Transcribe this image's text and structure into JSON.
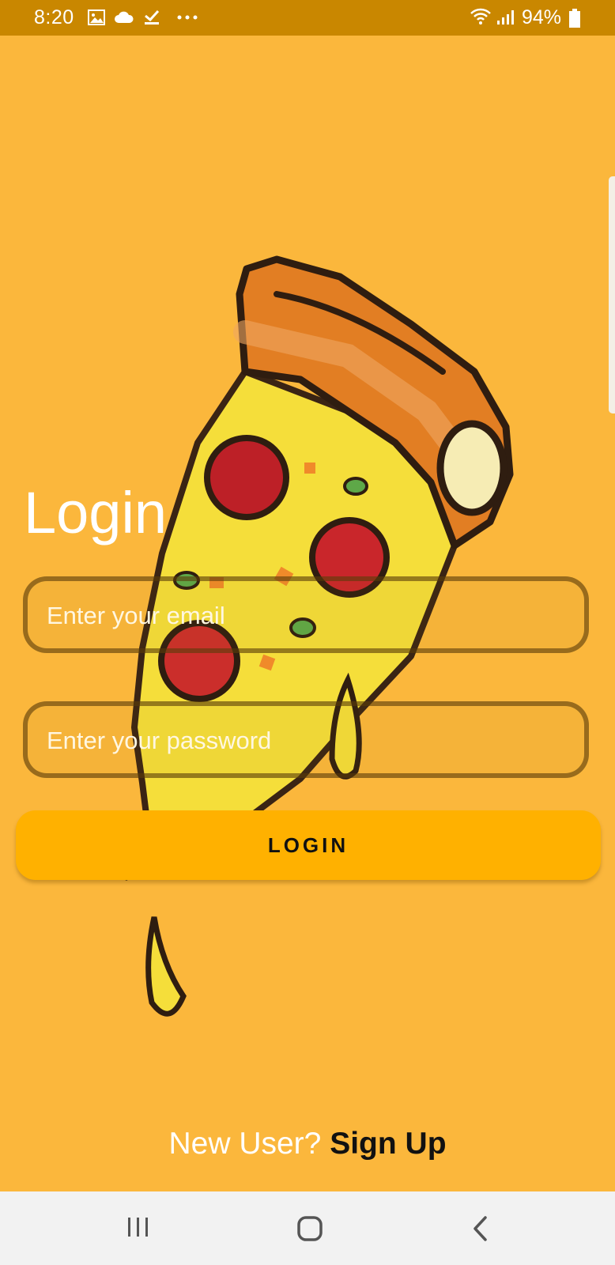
{
  "status_bar": {
    "time": "8:20",
    "battery": "94%",
    "left_icons": [
      "gallery-icon",
      "cloud-icon",
      "download-done-icon",
      "more-dots-icon"
    ],
    "right_icons": [
      "wifi-icon",
      "signal-icon",
      "battery-icon"
    ]
  },
  "login": {
    "title": "Login",
    "email_placeholder": "Enter your email",
    "password_placeholder": "Enter your password",
    "button_label": "LOGIN"
  },
  "signup": {
    "prompt": "New User?",
    "link_label": "Sign Up"
  },
  "nav_bar": {
    "buttons": [
      "recent-apps-icon",
      "home-icon",
      "back-icon"
    ]
  },
  "colors": {
    "background": "#fbb73c",
    "status_bar": "#c98700",
    "button": "#ffb100",
    "nav_bar": "#f2f2f2"
  }
}
